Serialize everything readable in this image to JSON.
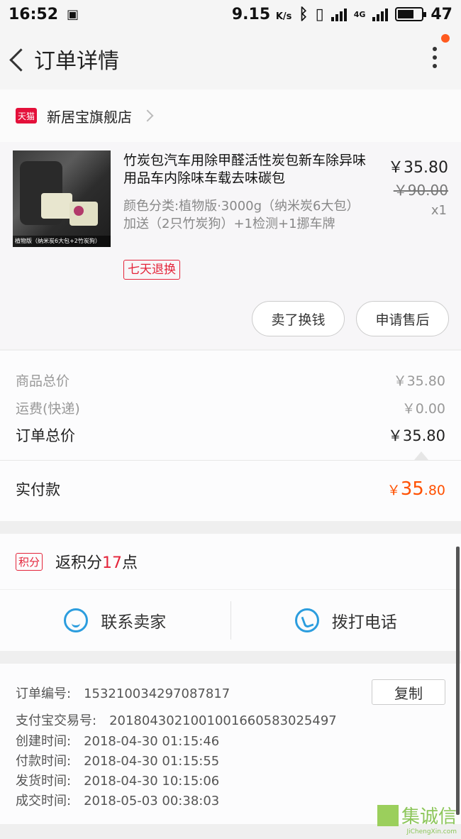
{
  "status_bar": {
    "time": "16:52",
    "speed": "9.15",
    "speed_unit": "K/s",
    "network": "4G",
    "battery": "47"
  },
  "header": {
    "title": "订单详情"
  },
  "shop": {
    "platform_badge": "天猫",
    "name": "新居宝旗舰店"
  },
  "product": {
    "image_caption": "植物版（纳米炭6大包+2竹炭狗）",
    "title": "竹炭包汽车用除甲醛活性炭包新车除异味用品车内除味车载去味碳包",
    "spec": "颜色分类:植物版·3000g（纳米炭6大包）加送（2只竹炭狗）+1检测+1挪车牌",
    "tag": "七天退换",
    "price": "￥35.80",
    "original_price": "￥90.00",
    "quantity": "x1",
    "buttons": {
      "sell": "卖了换钱",
      "aftersale": "申请售后"
    }
  },
  "totals": {
    "goods_label": "商品总价",
    "goods_value": "￥35.80",
    "shipping_label": "运费(快递)",
    "shipping_value": "￥0.00",
    "order_label": "订单总价",
    "order_value": "￥35.80",
    "paid_label": "实付款",
    "paid_currency": "￥",
    "paid_int": "35",
    "paid_dec": ".80"
  },
  "points": {
    "badge": "积分",
    "prefix": "返积分",
    "count": "17",
    "suffix": "点"
  },
  "contact": {
    "seller": "联系卖家",
    "phone": "拨打电话"
  },
  "order_info": {
    "copy_label": "复制",
    "rows": [
      {
        "label": "订单编号:",
        "value": "153210034297087817"
      },
      {
        "label": "支付宝交易号:",
        "value": "2018043021001001660583025497"
      },
      {
        "label": "创建时间:",
        "value": "2018-04-30 01:15:46"
      },
      {
        "label": "付款时间:",
        "value": "2018-04-30 01:15:55"
      },
      {
        "label": "发货时间:",
        "value": "2018-04-30 10:15:06"
      },
      {
        "label": "成交时间:",
        "value": "2018-05-03 00:38:03"
      }
    ]
  },
  "watermark": {
    "logo": "集诚信",
    "url": "JiChengXin.com"
  },
  "colors": {
    "accent": "#ff5000",
    "tag_red": "#e4243a",
    "icon_blue": "#2c9dde"
  }
}
